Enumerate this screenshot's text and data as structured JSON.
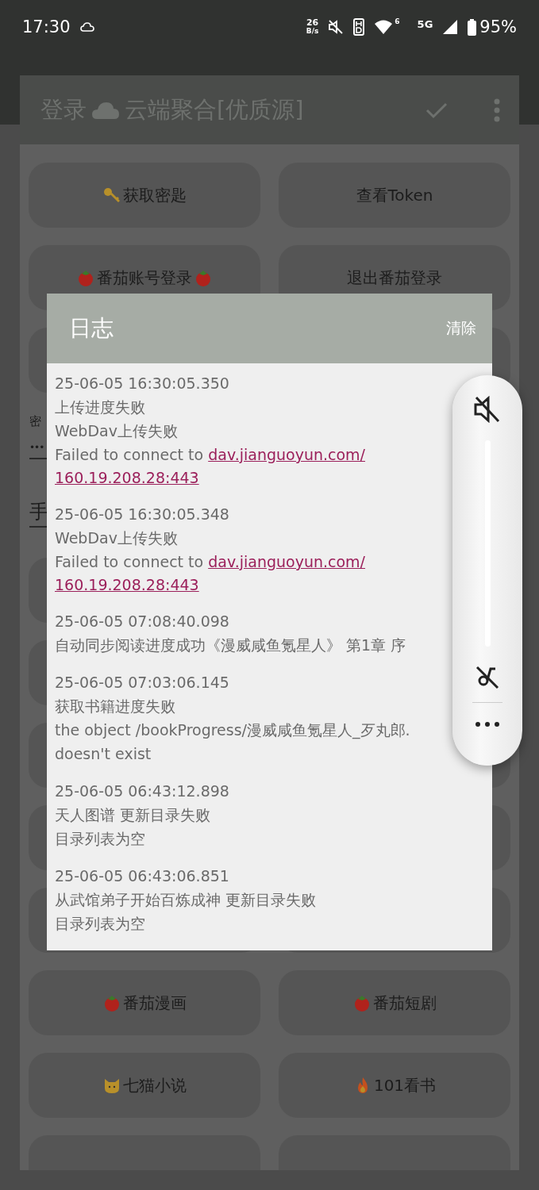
{
  "status_bar": {
    "time": "17:30",
    "speed_value": "26",
    "speed_unit": "B/s",
    "wifi_badge": "6",
    "network": "5G",
    "battery": "95%"
  },
  "window": {
    "title_prefix": "登录",
    "title": "云端聚合[优质源]"
  },
  "buttons_top": [
    {
      "label": "获取密匙",
      "kind": "key"
    },
    {
      "label": "查看Token",
      "kind": "plain"
    },
    {
      "label": "番茄账号登录",
      "kind": "tomato_pair"
    },
    {
      "label": "退出番茄登录",
      "kind": "plain"
    }
  ],
  "key_field": {
    "label": "密",
    "value": "•••"
  },
  "section_title": "手",
  "buttons_bottom": [
    {
      "label": "番茄漫画",
      "kind": "tomato"
    },
    {
      "label": "番茄短剧",
      "kind": "tomato"
    },
    {
      "label": "七猫小说",
      "kind": "cat"
    },
    {
      "label": "101看书",
      "kind": "fire"
    }
  ],
  "log_dialog": {
    "title": "日志",
    "clear_button": "清除",
    "entries": [
      {
        "time": "25-06-05 16:30:05.350",
        "lines": [
          {
            "text": "上传进度失败"
          },
          {
            "text": "WebDav上传失败"
          },
          {
            "text": "Failed to connect to ",
            "links": [
              "dav.jianguoyun.com/",
              "160.19.208.28:443"
            ]
          }
        ]
      },
      {
        "time": "25-06-05 16:30:05.348",
        "lines": [
          {
            "text": "WebDav上传失败"
          },
          {
            "text": "Failed to connect to ",
            "links": [
              "dav.jianguoyun.com/",
              "160.19.208.28:443"
            ]
          }
        ]
      },
      {
        "time": "25-06-05 07:08:40.098",
        "lines": [
          {
            "text": "自动同步阅读进度成功《漫威咸鱼氪星人》 第1章 序"
          }
        ]
      },
      {
        "time": "25-06-05 07:03:06.145",
        "lines": [
          {
            "text": "获取书籍进度失败"
          },
          {
            "text": "the object /bookProgress/漫威咸鱼氪星人_歹丸郎."
          },
          {
            "text": "doesn't exist"
          }
        ]
      },
      {
        "time": "25-06-05 06:43:12.898",
        "lines": [
          {
            "text": "天人图谱 更新目录失败"
          },
          {
            "text": "目录列表为空"
          }
        ]
      },
      {
        "time": "25-06-05 06:43:06.851",
        "lines": [
          {
            "text": "从武馆弟子开始百炼成神 更新目录失败"
          },
          {
            "text": "目录列表为空"
          }
        ]
      }
    ]
  },
  "volume_panel": {
    "muted": true,
    "level": 0
  }
}
